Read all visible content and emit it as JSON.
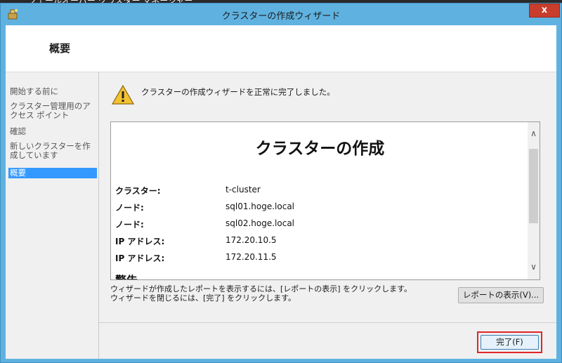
{
  "window": {
    "title": "クラスターの作成ウィザード",
    "close_label": "x",
    "behind_text": "フェールオーバー クラスター マネージャー"
  },
  "header": {
    "title": "概要"
  },
  "nav": {
    "items": [
      {
        "label": "開始する前に",
        "active": false
      },
      {
        "label": "クラスター管理用のアクセス ポイント",
        "active": false
      },
      {
        "label": "確認",
        "active": false
      },
      {
        "label": "新しいクラスターを作成しています",
        "active": false
      },
      {
        "label": "概要",
        "active": true
      }
    ]
  },
  "main": {
    "message": "クラスターの作成ウィザードを正常に完了しました。",
    "report": {
      "title": "クラスターの作成",
      "rows": [
        {
          "label": "クラスター:",
          "value": "t-cluster"
        },
        {
          "label": "ノード:",
          "value": "sql01.hoge.local"
        },
        {
          "label": "ノード:",
          "value": "sql02.hoge.local"
        },
        {
          "label": "IP アドレス:",
          "value": "172.20.10.5"
        },
        {
          "label": "IP アドレス:",
          "value": "172.20.11.5"
        }
      ],
      "partial_heading": "警告"
    },
    "info_line1": "ウィザードが作成したレポートを表示するには、[レポートの表示] をクリックします。",
    "info_line2": "ウィザードを閉じるには、[完了] をクリックします。",
    "view_report_label": "レポートの表示(V)...",
    "finish_label": "完了(F)"
  },
  "colors": {
    "accent": "#3399ff",
    "highlight": "#e0262b",
    "titlebar": "#5fb2e0",
    "close": "#c83d2c"
  }
}
